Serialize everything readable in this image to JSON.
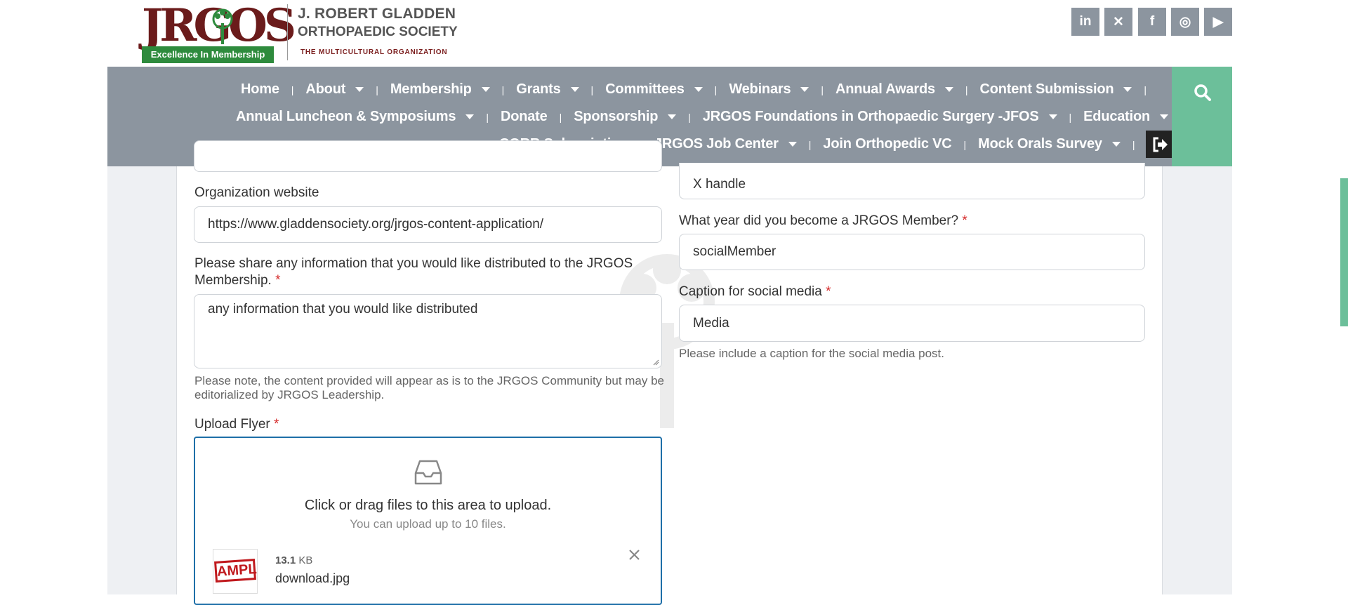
{
  "header": {
    "logo_mark": "JRGOS",
    "logo_tagline": "Excellence In Membership",
    "org_name_line1": "J. ROBERT GLADDEN",
    "org_name_line2": "ORTHOPAEDIC SOCIETY",
    "org_subtitle": "THE MULTICULTURAL ORGANIZATION",
    "social_icons": [
      "linkedin-icon",
      "x-icon",
      "facebook-icon",
      "instagram-icon",
      "youtube-icon"
    ],
    "social_glyphs": [
      "in",
      "✕",
      "f",
      "◎",
      "▶"
    ]
  },
  "nav": {
    "row1": [
      {
        "label": "Home",
        "dropdown": false
      },
      {
        "label": "About",
        "dropdown": true
      },
      {
        "label": "Membership",
        "dropdown": true
      },
      {
        "label": "Grants",
        "dropdown": true
      },
      {
        "label": "Committees",
        "dropdown": true
      },
      {
        "label": "Webinars",
        "dropdown": true
      },
      {
        "label": "Annual Awards",
        "dropdown": true
      },
      {
        "label": "Content Submission",
        "dropdown": true
      }
    ],
    "row2": [
      {
        "label": "Annual Luncheon & Symposiums",
        "dropdown": true
      },
      {
        "label": "Donate",
        "dropdown": false
      },
      {
        "label": "Sponsorship",
        "dropdown": true
      },
      {
        "label": "JRGOS Foundations in Orthopaedic Surgery -JFOS",
        "dropdown": true
      },
      {
        "label": "Education",
        "dropdown": true
      }
    ],
    "row3": [
      {
        "label": "CORR Subscription",
        "dropdown": false
      },
      {
        "label": "JRGOS Job Center",
        "dropdown": true
      },
      {
        "label": "Join Orthopedic VC",
        "dropdown": false
      },
      {
        "label": "Mock Orals Survey",
        "dropdown": true
      }
    ]
  },
  "form": {
    "org_website_label": "Organization website",
    "org_website_value": "https://www.gladdensociety.org/jrgos-content-application/",
    "share_info_label": "Please share any information that you would like distributed to the JRGOS Membership.",
    "share_info_value": "any information that you would like distributed",
    "share_info_help": "Please note, the content provided will appear as is to the JRGOS Community but may be editorialized by JRGOS Leadership.",
    "upload_label": "Upload Flyer",
    "upload_prompt": "Click or drag files to this area to upload.",
    "upload_limit": "You can upload up to 10 files.",
    "file_size_number": "13.1",
    "file_size_unit": "KB",
    "file_name": "download.jpg",
    "file_thumb_text": "AMPL",
    "x_handle_value": "X handle",
    "member_year_label": "What year did you become a JRGOS Member?",
    "member_year_value": "socialMember",
    "caption_label": "Caption for social media",
    "caption_value": "Media",
    "caption_help": "Please include a caption for the social media post.",
    "required_mark": "*"
  },
  "colors": {
    "nav_bg": "#8c959f",
    "search_bg": "#6cbf9a",
    "brand_red": "#6b1b1b",
    "brand_green": "#2e8b3d",
    "upload_border": "#1e6fa8",
    "required": "#d52b2b"
  }
}
